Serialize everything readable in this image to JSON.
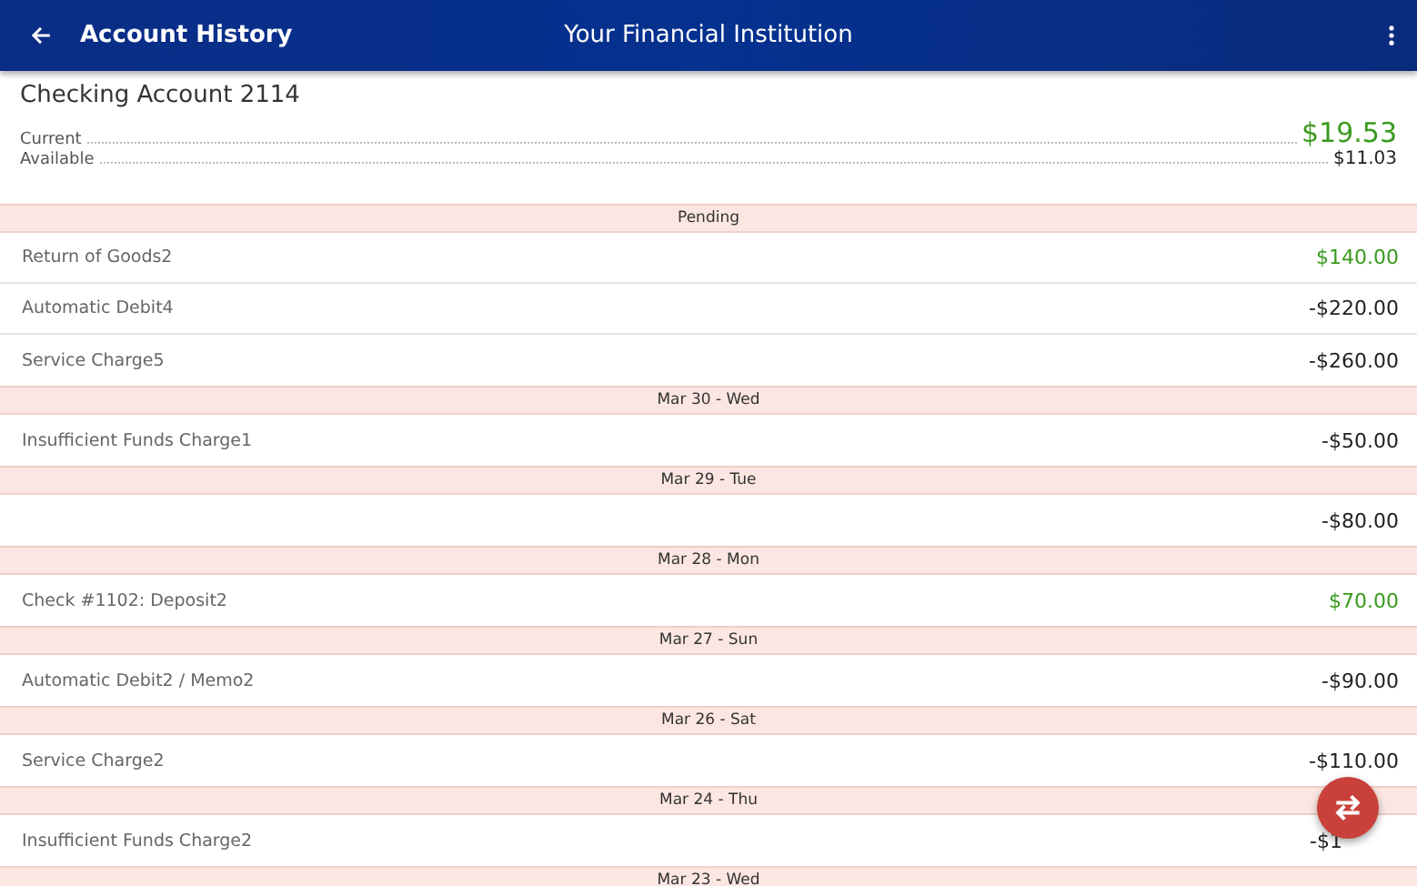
{
  "app_bar": {
    "title": "Account History",
    "subtitle": "Your Financial Institution"
  },
  "account": {
    "name": "Checking Account 2114",
    "balances": [
      {
        "label": "Current",
        "amount": "$19.53",
        "kind": "primary"
      },
      {
        "label": "Available",
        "amount": "$11.03",
        "kind": "secondary"
      }
    ]
  },
  "sections": [
    {
      "header": "Pending",
      "transactions": [
        {
          "description": "Return of Goods2",
          "amount": "$140.00",
          "kind": "credit"
        },
        {
          "description": "Automatic Debit4",
          "amount": "-$220.00",
          "kind": "debit"
        },
        {
          "description": "Service Charge5",
          "amount": "-$260.00",
          "kind": "debit"
        }
      ]
    },
    {
      "header": "Mar 30 - Wed",
      "transactions": [
        {
          "description": "Insufficient Funds Charge1",
          "amount": "-$50.00",
          "kind": "debit"
        }
      ]
    },
    {
      "header": "Mar 29 - Tue",
      "transactions": [
        {
          "amount": "-$80.00",
          "kind": "debit"
        }
      ]
    },
    {
      "header": "Mar 28 - Mon",
      "transactions": [
        {
          "description": "Check #1102: Deposit2",
          "amount": "$70.00",
          "kind": "credit"
        }
      ]
    },
    {
      "header": "Mar 27 - Sun",
      "transactions": [
        {
          "description": "Automatic Debit2 / Memo2",
          "amount": "-$90.00",
          "kind": "debit"
        }
      ]
    },
    {
      "header": "Mar 26 - Sat",
      "transactions": [
        {
          "description": "Service Charge2",
          "amount": "-$110.00",
          "kind": "debit"
        }
      ]
    },
    {
      "header": "Mar 24 - Thu",
      "transactions": [
        {
          "description": "Insufficient Funds Charge2",
          "amount": "-$1",
          "kind": "debit",
          "covered": true
        }
      ]
    },
    {
      "header": "Mar 23 - Wed"
    }
  ]
}
